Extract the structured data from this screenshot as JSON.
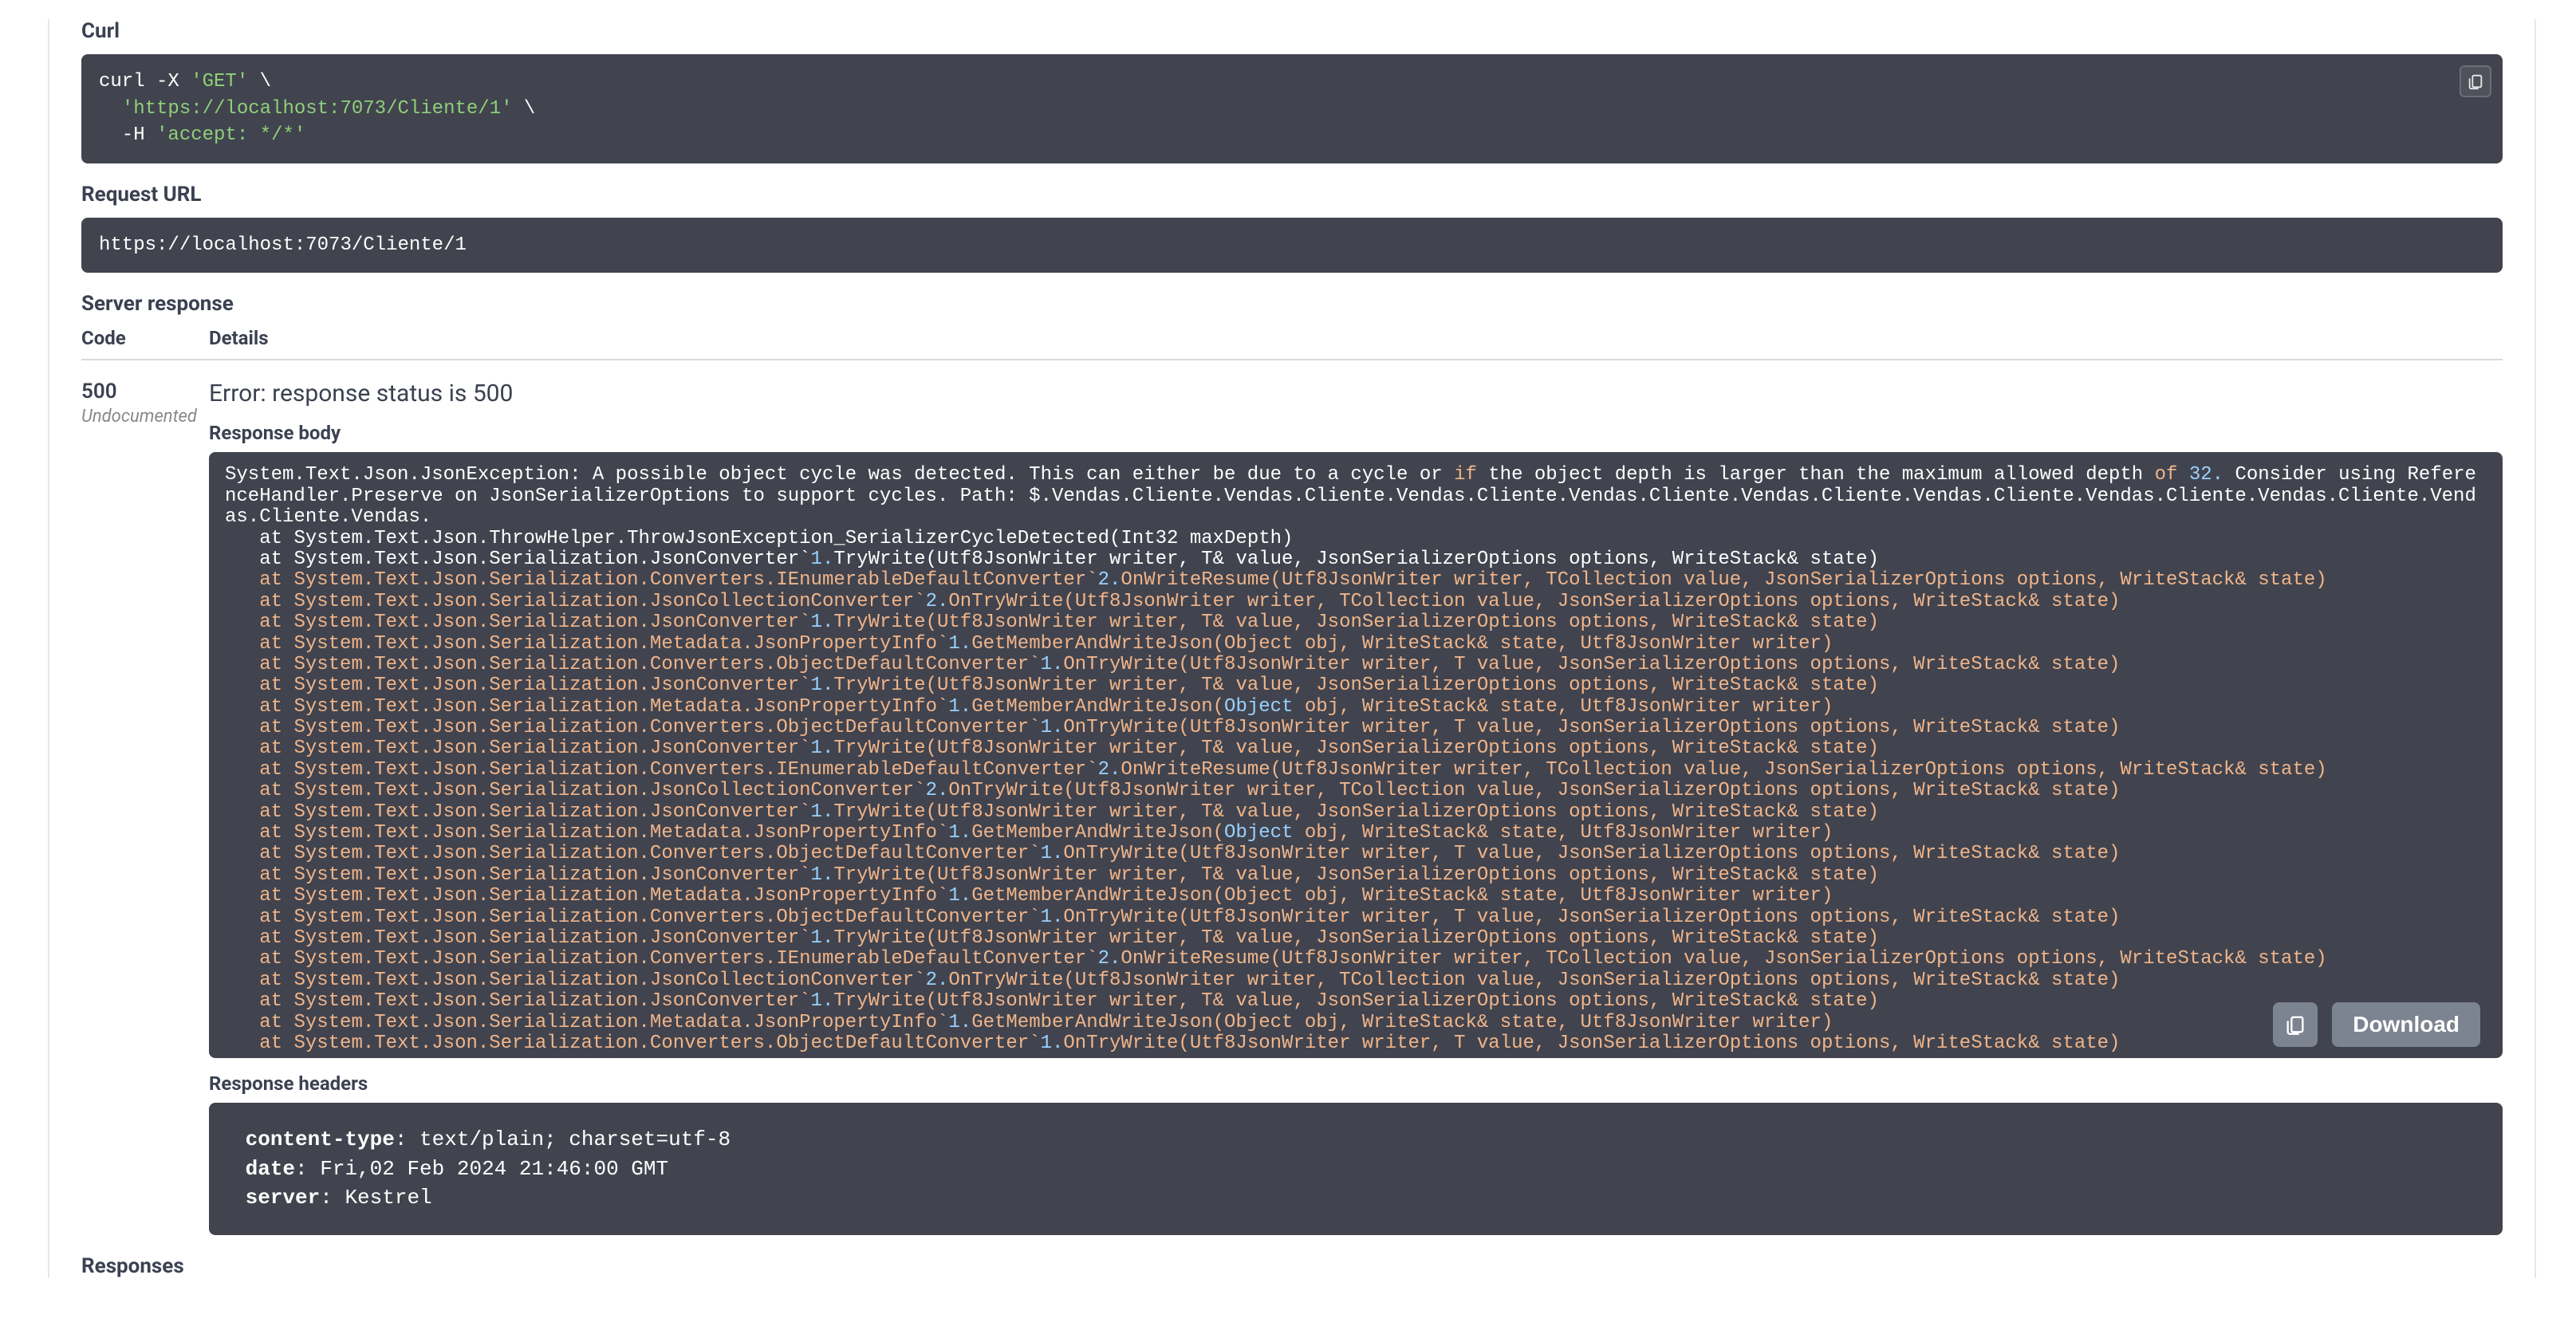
{
  "curl": {
    "label": "Curl",
    "line1a": "curl -X ",
    "line1b": "'GET'",
    "line1c": " \\",
    "line2a": "  ",
    "line2b": "'https://localhost:7073/Cliente/1'",
    "line2c": " \\",
    "line3a": "  -H ",
    "line3b": "'accept: */*'"
  },
  "request_url": {
    "label": "Request URL",
    "value": "https://localhost:7073/Cliente/1"
  },
  "server_response_label": "Server response",
  "columns": {
    "code": "Code",
    "details": "Details"
  },
  "status": {
    "code": "500",
    "undocumented": "Undocumented"
  },
  "error_line": "Error: response status is 500",
  "response_body_label": "Response body",
  "download_label": "Download",
  "trace": {
    "head_a": "System.Text.Json.JsonException: A possible object cycle was detected. This can either be due to a cycle or ",
    "head_if": "if",
    "head_b": " the object depth is larger than the maximum allowed depth ",
    "head_of": "of",
    "head_c": " ",
    "head_num": "32.",
    "head_d": " Consider using ReferenceHandler.Preserve on JsonSerializerOptions to support cycles. Path: $.Vendas.Cliente.Vendas.Cliente.Vendas.Cliente.Vendas.Cliente.Vendas.Cliente.Vendas.Cliente.Vendas.Cliente.Vendas.Cliente.Vendas.Cliente.Vendas.",
    "lines": [
      {
        "at": true,
        "w": true,
        "a": "System.Text.Json.ThrowHelper.ThrowJsonException_SerializerCycleDetected(Int32 maxDepth)",
        "b": "",
        "c": ""
      },
      {
        "at": true,
        "w": true,
        "a": "System.Text.Json.Serialization.JsonConverter`",
        "b": "1.",
        "c": "TryWrite(Utf8JsonWriter writer, T& value, JsonSerializerOptions options, WriteStack& state)"
      },
      {
        "at": true,
        "w": false,
        "a": "System.Text.Json.Serialization.Converters.IEnumerableDefaultConverter`",
        "b": "2.",
        "c": "OnWriteResume(Utf8JsonWriter writer, TCollection value, JsonSerializerOptions options, WriteStack& state)"
      },
      {
        "at": true,
        "w": false,
        "a": "System.Text.Json.Serialization.JsonCollectionConverter`",
        "b": "2.",
        "c": "OnTryWrite(Utf8JsonWriter writer, TCollection value, JsonSerializerOptions options, WriteStack& state)"
      },
      {
        "at": true,
        "w": false,
        "a": "System.Text.Json.Serialization.JsonConverter`",
        "b": "1.",
        "c": "TryWrite(Utf8JsonWriter writer, T& value, JsonSerializerOptions options, WriteStack& state)"
      },
      {
        "at": true,
        "w": false,
        "a": "System.Text.Json.Serialization.Metadata.JsonPropertyInfo`",
        "b": "1.",
        "c": "GetMemberAndWriteJson(Object obj, WriteStack& state, Utf8JsonWriter writer)"
      },
      {
        "at": true,
        "w": false,
        "a": "System.Text.Json.Serialization.Converters.ObjectDefaultConverter`",
        "b": "1.",
        "c": "OnTryWrite(Utf8JsonWriter writer, T value, JsonSerializerOptions options, WriteStack& state)"
      },
      {
        "at": true,
        "w": false,
        "a": "System.Text.Json.Serialization.JsonConverter`",
        "b": "1.",
        "c": "TryWrite(Utf8JsonWriter writer, T& value, JsonSerializerOptions options, WriteStack& state)"
      },
      {
        "at": true,
        "w": false,
        "a": "System.Text.Json.Serialization.Metadata.JsonPropertyInfo`",
        "b": "1.",
        "c": "GetMemberAndWriteJson(",
        "obj": "Object",
        "c2": " obj, WriteStack& state, Utf8JsonWriter writer)"
      },
      {
        "at": true,
        "w": false,
        "a": "System.Text.Json.Serialization.Converters.ObjectDefaultConverter`",
        "b": "1.",
        "c": "OnTryWrite(Utf8JsonWriter writer, T value, JsonSerializerOptions options, WriteStack& state)"
      },
      {
        "at": true,
        "w": false,
        "a": "System.Text.Json.Serialization.JsonConverter`",
        "b": "1.",
        "c": "TryWrite(Utf8JsonWriter writer, T& value, JsonSerializerOptions options, WriteStack& state)"
      },
      {
        "at": true,
        "w": false,
        "a": "System.Text.Json.Serialization.Converters.IEnumerableDefaultConverter`",
        "b": "2.",
        "c": "OnWriteResume(Utf8JsonWriter writer, TCollection value, JsonSerializerOptions options, WriteStack& state)"
      },
      {
        "at": true,
        "w": false,
        "a": "System.Text.Json.Serialization.JsonCollectionConverter`",
        "b": "2.",
        "c": "OnTryWrite(Utf8JsonWriter writer, TCollection value, JsonSerializerOptions options, WriteStack& state)"
      },
      {
        "at": true,
        "w": false,
        "a": "System.Text.Json.Serialization.JsonConverter`",
        "b": "1.",
        "c": "TryWrite(Utf8JsonWriter writer, T& value, JsonSerializerOptions options, WriteStack& state)"
      },
      {
        "at": true,
        "w": false,
        "a": "System.Text.Json.Serialization.Metadata.JsonPropertyInfo`",
        "b": "1.",
        "c": "GetMemberAndWriteJson(",
        "obj": "Object",
        "c2": " obj, WriteStack& state, Utf8JsonWriter writer)"
      },
      {
        "at": true,
        "w": false,
        "a": "System.Text.Json.Serialization.Converters.ObjectDefaultConverter`",
        "b": "1.",
        "c": "OnTryWrite(Utf8JsonWriter writer, T value, JsonSerializerOptions options, WriteStack& state)"
      },
      {
        "at": true,
        "w": false,
        "a": "System.Text.Json.Serialization.JsonConverter`",
        "b": "1.",
        "c": "TryWrite(Utf8JsonWriter writer, T& value, JsonSerializerOptions options, WriteStack& state)"
      },
      {
        "at": true,
        "w": false,
        "a": "System.Text.Json.Serialization.Metadata.JsonPropertyInfo`",
        "b": "1.",
        "c": "GetMemberAndWriteJson(Object obj, WriteStack& state, Utf8JsonWriter writer)"
      },
      {
        "at": true,
        "w": false,
        "a": "System.Text.Json.Serialization.Converters.ObjectDefaultConverter`",
        "b": "1.",
        "c": "OnTryWrite(Utf8JsonWriter writer, T value, JsonSerializerOptions options, WriteStack& state)"
      },
      {
        "at": true,
        "w": false,
        "a": "System.Text.Json.Serialization.JsonConverter`",
        "b": "1.",
        "c": "TryWrite(Utf8JsonWriter writer, T& value, JsonSerializerOptions options, WriteStack& state)"
      },
      {
        "at": true,
        "w": false,
        "a": "System.Text.Json.Serialization.Converters.IEnumerableDefaultConverter`",
        "b": "2.",
        "c": "OnWriteResume(Utf8JsonWriter writer, TCollection value, JsonSerializerOptions options, WriteStack& state)"
      },
      {
        "at": true,
        "w": false,
        "a": "System.Text.Json.Serialization.JsonCollectionConverter`",
        "b": "2.",
        "c": "OnTryWrite(Utf8JsonWriter writer, TCollection value, JsonSerializerOptions options, WriteStack& state)"
      },
      {
        "at": true,
        "w": false,
        "a": "System.Text.Json.Serialization.JsonConverter`",
        "b": "1.",
        "c": "TryWrite(Utf8JsonWriter writer, T& value, JsonSerializerOptions options, WriteStack& state)"
      },
      {
        "at": true,
        "w": false,
        "a": "System.Text.Json.Serialization.Metadata.JsonPropertyInfo`",
        "b": "1.",
        "c": "GetMemberAndWriteJson(Object obj, WriteStack& state, Utf8JsonWriter writer)"
      },
      {
        "at": true,
        "w": false,
        "a": "System.Text.Json.Serialization.Converters.ObjectDefaultConverter`",
        "b": "1.",
        "c": "OnTryWrite(Utf8JsonWriter writer, T value, JsonSerializerOptions options, WriteStack& state)"
      }
    ]
  },
  "response_headers_label": "Response headers",
  "headers": [
    {
      "k": "content-type",
      "v": "text/plain; charset=utf-8"
    },
    {
      "k": "date",
      "v": "Fri,02 Feb 2024 21:46:00 GMT"
    },
    {
      "k": "server",
      "v": "Kestrel"
    }
  ],
  "responses_label": "Responses"
}
